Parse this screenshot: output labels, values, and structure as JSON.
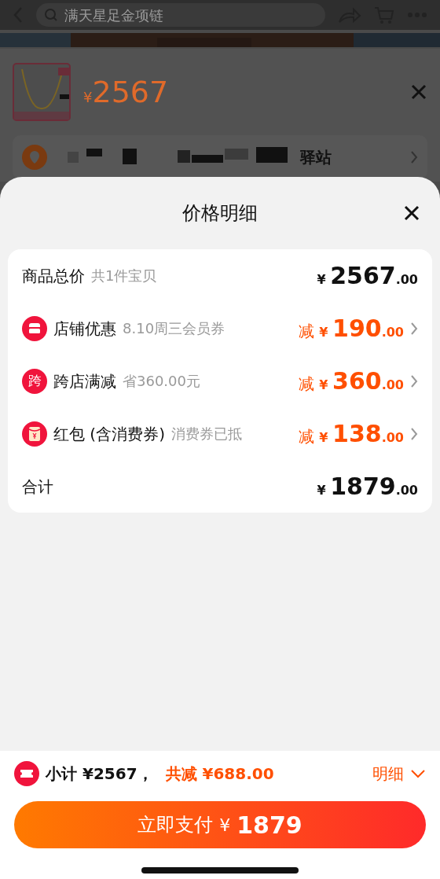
{
  "backdrop": {
    "search": {
      "value": "满天星足金项链"
    },
    "product": {
      "currency": "¥",
      "price": "2567"
    },
    "address": {
      "text": "驿站"
    }
  },
  "sheet": {
    "title": "价格明细"
  },
  "rows": [
    {
      "kind": "total",
      "label": "商品总价",
      "note": "共1件宝贝",
      "currency": "¥",
      "integer": "2567",
      "decimal": ".00"
    },
    {
      "kind": "store",
      "label": "店铺优惠",
      "note": "8.10周三会员券",
      "prefix": "减",
      "currency": "¥",
      "integer": "190",
      "decimal": ".00"
    },
    {
      "kind": "cross_store",
      "icon_text": "跨",
      "label": "跨店满减",
      "note": "省360.00元",
      "prefix": "减",
      "currency": "¥",
      "integer": "360",
      "decimal": ".00"
    },
    {
      "kind": "packet",
      "label": "红包 (含消费券)",
      "note": "消费券已抵",
      "prefix": "减",
      "currency": "¥",
      "integer": "138",
      "decimal": ".00"
    },
    {
      "kind": "sum",
      "label": "合计",
      "currency": "¥",
      "integer": "1879",
      "decimal": ".00"
    }
  ],
  "footer": {
    "subtotal": "小计 ¥2567，",
    "saved": "共减 ¥688.00",
    "detail": "明细",
    "expanded": false,
    "pay": {
      "label": "立即支付",
      "currency": "¥",
      "amount": "1879"
    }
  }
}
